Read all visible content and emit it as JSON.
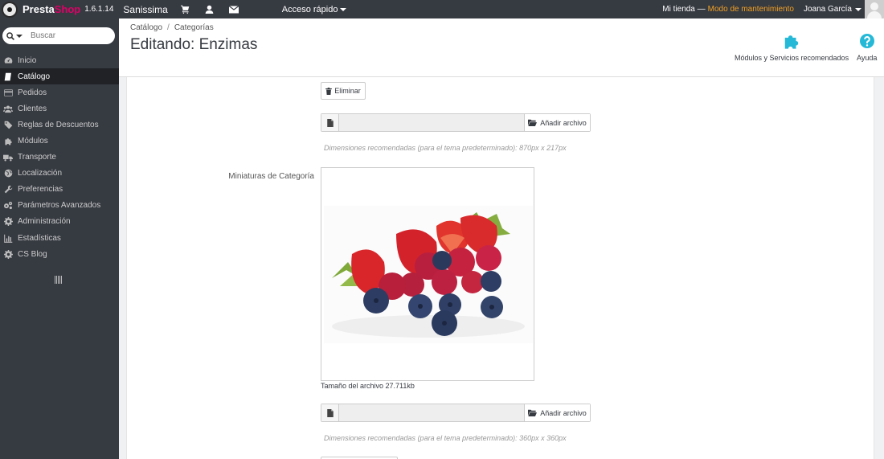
{
  "topbar": {
    "brand_presta": "Presta",
    "brand_shop": "Shop",
    "version": "1.6.1.14",
    "shop_name": "Sanissima",
    "quick_access": "Acceso rápido",
    "store_link": "Mi tienda —",
    "maintenance": "Modo de mantenimiento",
    "user_name": "Joana García"
  },
  "sidebar": {
    "search_placeholder": "Buscar",
    "items": [
      {
        "label": "Inicio",
        "icon": "dashboard-icon"
      },
      {
        "label": "Catálogo",
        "icon": "book-icon"
      },
      {
        "label": "Pedidos",
        "icon": "credit-card-icon"
      },
      {
        "label": "Clientes",
        "icon": "users-icon"
      },
      {
        "label": "Reglas de Descuentos",
        "icon": "tag-icon"
      },
      {
        "label": "Módulos",
        "icon": "puzzle-icon"
      },
      {
        "label": "Transporte",
        "icon": "truck-icon"
      },
      {
        "label": "Localización",
        "icon": "globe-icon"
      },
      {
        "label": "Preferencias",
        "icon": "wrench-icon"
      },
      {
        "label": "Parámetros Avanzados",
        "icon": "cogs-icon"
      },
      {
        "label": "Administración",
        "icon": "cog-icon"
      },
      {
        "label": "Estadísticas",
        "icon": "bar-chart-icon"
      },
      {
        "label": "CS Blog",
        "icon": "cog-icon"
      }
    ],
    "active_index": 1
  },
  "header": {
    "breadcrumb": [
      "Catálogo",
      "Categorías"
    ],
    "breadcrumb_sep": "/",
    "title": "Editando: Enzimas",
    "toolbar": [
      {
        "label": "Módulos y Servicios recomendados",
        "icon": "puzzle-icon"
      },
      {
        "label": "Ayuda",
        "icon": "help-icon"
      }
    ]
  },
  "form": {
    "delete_label": "Eliminar",
    "add_file_label": "Añadir archivo",
    "hint_cover": "Dimensiones recomendadas (para el tema predeterminado): 870px x 217px",
    "thumbnail_label": "Miniaturas de Categoría",
    "file_size": "Tamaño del archivo 27.711kb",
    "hint_thumbnail": "Dimensiones recomendadas (para el tema predeterminado): 360px x 360px"
  },
  "colors": {
    "topbar_bg": "#363a41",
    "brand_shop": "#df0067",
    "maintenance": "#f0a024",
    "toolbar_icon": "#25b9d7"
  }
}
